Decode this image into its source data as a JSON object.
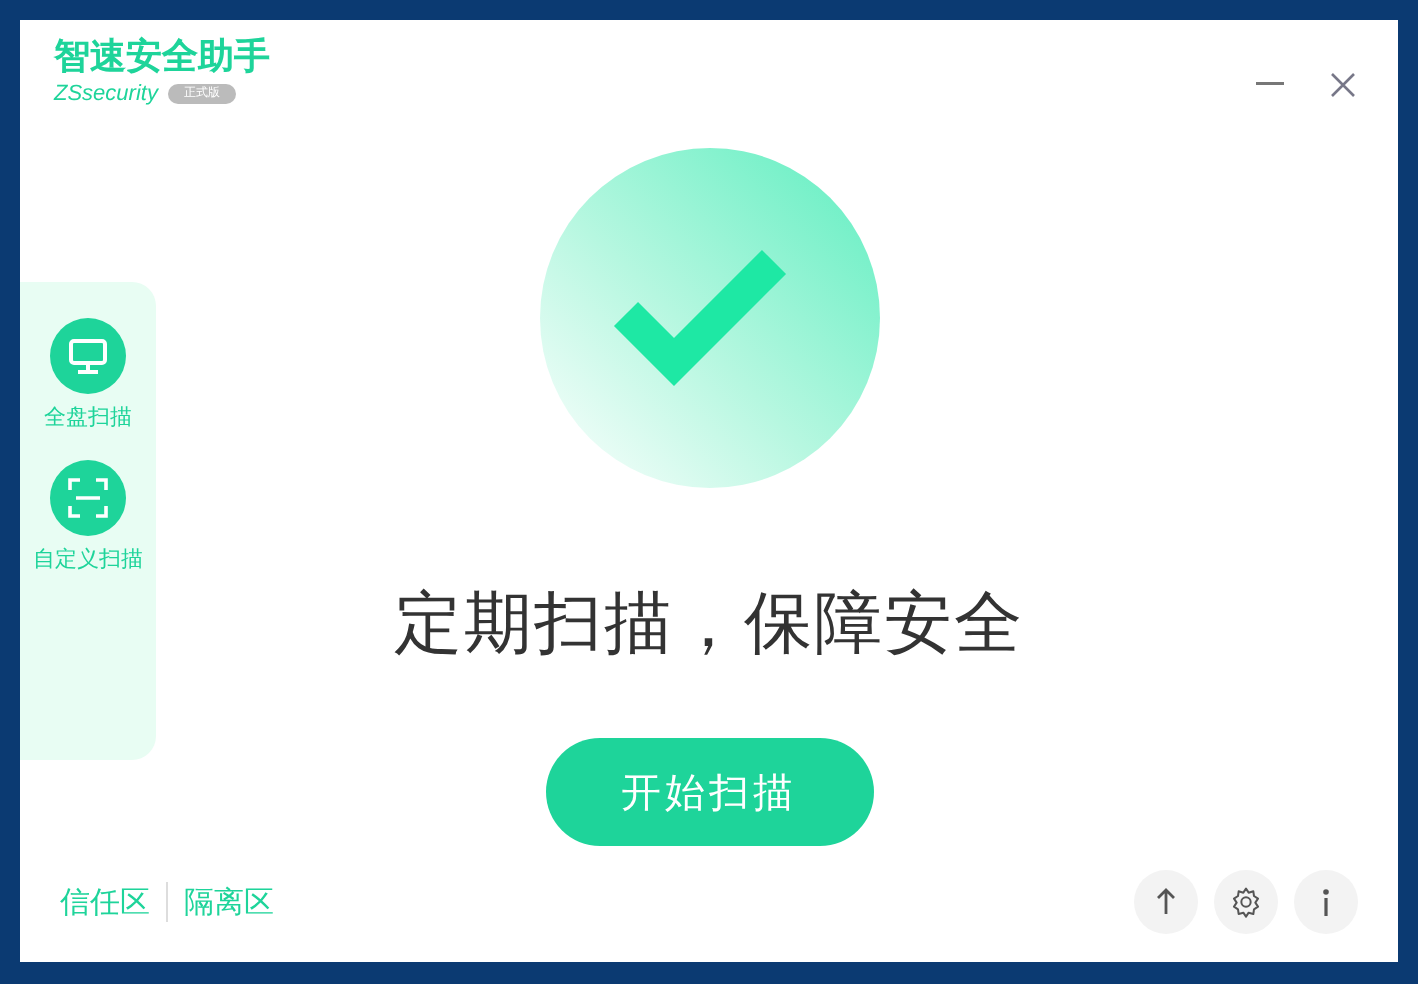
{
  "window": {
    "title": "智速安全助手",
    "subtitle": "ZSsecurity",
    "badge": "正式版",
    "controls": [
      {
        "kind": "minimize"
      },
      {
        "kind": "close"
      }
    ]
  },
  "sidebar": {
    "items": [
      {
        "label": "全盘扫描",
        "kind": "monitor"
      },
      {
        "label": "自定义扫描",
        "kind": "scan"
      }
    ]
  },
  "main": {
    "headline": "定期扫描，保障安全",
    "button": "开始扫描"
  },
  "footer": {
    "links": [
      "信任区",
      "隔离区"
    ],
    "buttons": [
      {
        "kind": "upload"
      },
      {
        "kind": "settings"
      },
      {
        "kind": "info"
      }
    ]
  }
}
